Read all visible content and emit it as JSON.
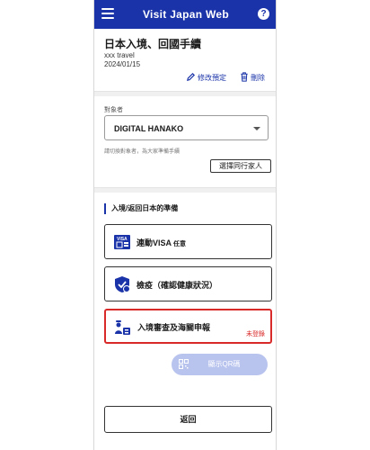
{
  "header": {
    "title": "Visit Japan Web",
    "menu_icon": "hamburger-menu-icon",
    "help_icon": "question-icon",
    "help_glyph": "?"
  },
  "trip": {
    "title": "日本入境、回國手續",
    "agency": "xxx travel",
    "date": "2024/01/15",
    "edit_label": "修改預定",
    "delete_label": "刪除"
  },
  "target": {
    "label": "對象者",
    "selected": "DIGITAL HANAKO",
    "hint": "請切換對象者，為大家準備手續",
    "companion_button": "選擇同行家人"
  },
  "prep": {
    "heading": "入境/返回日本的準備",
    "items": [
      {
        "label": "連動VISA",
        "tag": "任意",
        "icon": "visa-icon",
        "status": ""
      },
      {
        "label": "檢疫（確認健康狀況）",
        "tag": "",
        "icon": "health-shield-icon",
        "status": ""
      },
      {
        "label": "入境審查及海關申報",
        "tag": "",
        "icon": "immigration-officer-icon",
        "status": "未登錄"
      }
    ]
  },
  "qr_button": "顯示QR碼",
  "back_button": "返回",
  "colors": {
    "brand": "#1a33a8",
    "alert": "#d92a2a",
    "qr_disabled": "#b8c3ee"
  }
}
